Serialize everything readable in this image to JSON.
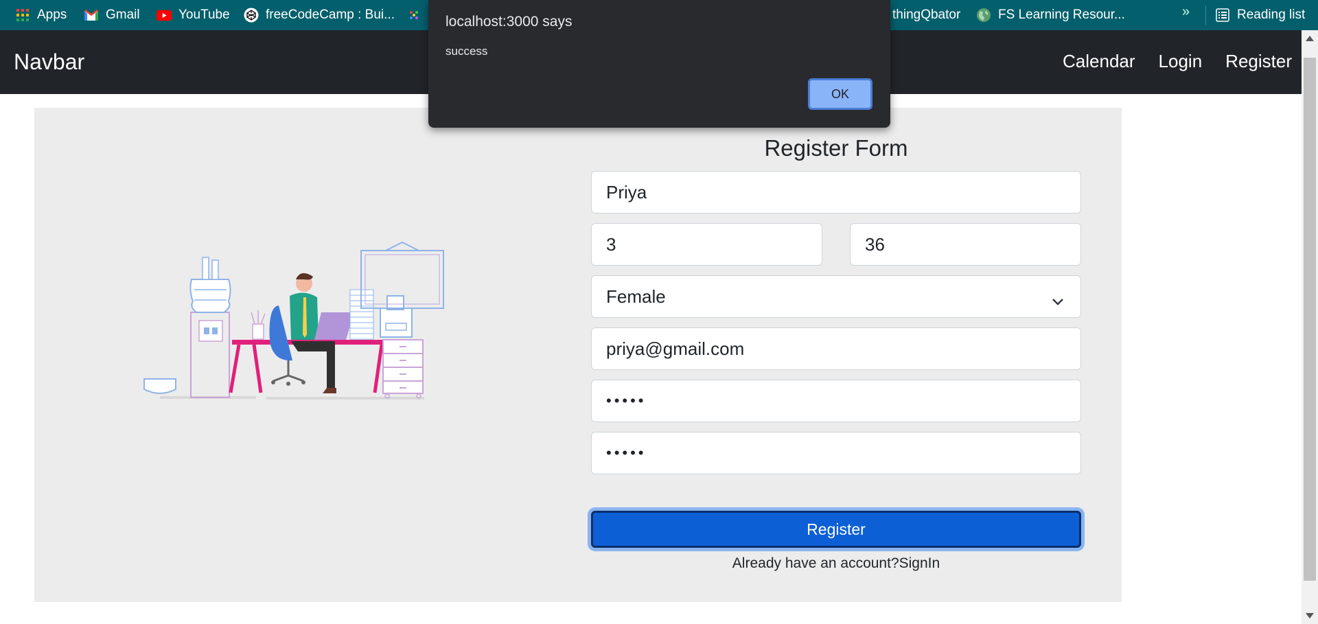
{
  "bookmarks": {
    "items": [
      {
        "label": "Apps",
        "icon": "apps-grid-icon"
      },
      {
        "label": "Gmail",
        "icon": "gmail-icon"
      },
      {
        "label": "YouTube",
        "icon": "youtube-icon"
      },
      {
        "label": "freeCodeCamp : Bui...",
        "icon": "codepen-icon"
      },
      {
        "label": "thingQbator",
        "icon": ""
      },
      {
        "label": "FS Learning Resour...",
        "icon": "globe-icon"
      }
    ],
    "more": "»",
    "reading_list": "Reading list",
    "colors": {
      "background": "#035f6c"
    }
  },
  "navbar": {
    "brand": "Navbar",
    "links": [
      "Calendar",
      "Login",
      "Register"
    ],
    "colors": {
      "background": "#212529"
    }
  },
  "form": {
    "title": "Register Form",
    "name_value": "Priya",
    "field_a_value": "3",
    "field_b_value": "36",
    "gender_selected": "Female",
    "email_value": "priya@gmail.com",
    "password_mask": "•••••",
    "confirm_mask": "•••••",
    "submit_label": "Register",
    "signin_prompt": "Already have an account?SignIn",
    "colors": {
      "button": "#0d5fd6",
      "panel": "#ececec"
    }
  },
  "dialog": {
    "title": "localhost:3000 says",
    "message": "success",
    "ok_label": "OK",
    "colors": {
      "background": "#292a2d",
      "ok": "#8ab4f8"
    }
  }
}
